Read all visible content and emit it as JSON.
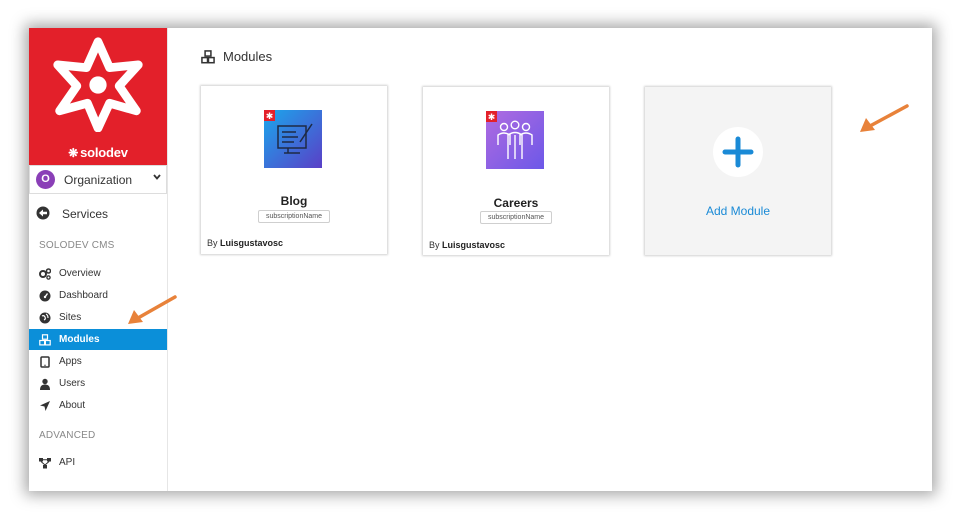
{
  "brand": {
    "name": "solodev",
    "color": "#e3202a"
  },
  "org": {
    "avatar_letter": "O",
    "label": "Organization"
  },
  "services": {
    "label": "Services"
  },
  "sections": {
    "cms": "SOLODEV CMS",
    "advanced": "ADVANCED"
  },
  "nav": [
    {
      "label": "Overview",
      "icon": "gears-icon"
    },
    {
      "label": "Dashboard",
      "icon": "dashboard-icon"
    },
    {
      "label": "Sites",
      "icon": "globe-icon"
    },
    {
      "label": "Modules",
      "icon": "cubes-icon",
      "active": true
    },
    {
      "label": "Apps",
      "icon": "tablet-icon"
    },
    {
      "label": "Users",
      "icon": "user-icon"
    },
    {
      "label": "About",
      "icon": "location-arrow-icon"
    }
  ],
  "advanced_nav": [
    {
      "label": "API",
      "icon": "api-icon"
    }
  ],
  "page": {
    "title": "Modules"
  },
  "modules": [
    {
      "name": "Blog",
      "tag": "subscriptionName",
      "by_prefix": "By",
      "author": "Luisgustavosc",
      "icon": "blog-icon"
    },
    {
      "name": "Careers",
      "tag": "subscriptionName",
      "by_prefix": "By",
      "author": "Luisgustavosc",
      "icon": "careers-icon"
    }
  ],
  "add_module": {
    "label": "Add Module"
  },
  "colors": {
    "accent": "#0b8fd9",
    "annotation_arrow": "#e8823a"
  }
}
